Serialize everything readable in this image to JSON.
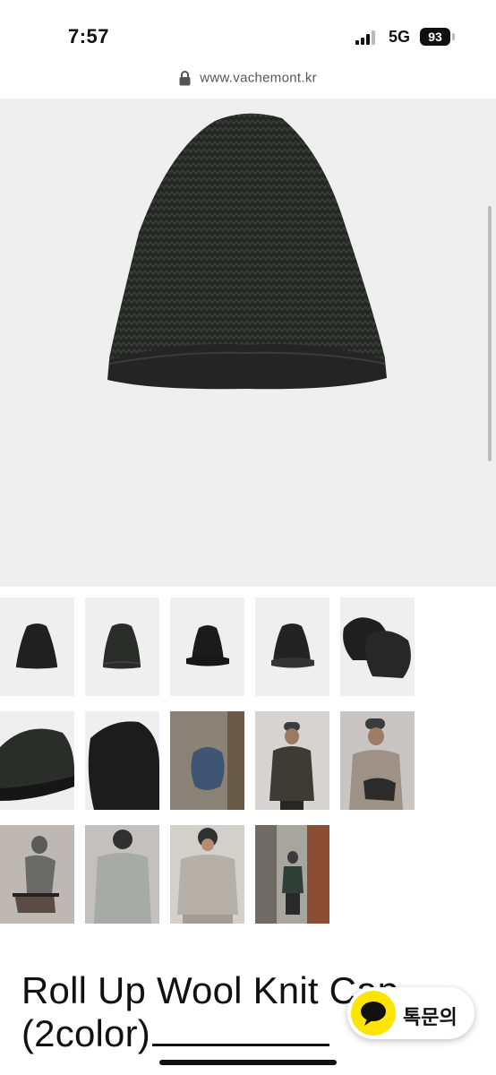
{
  "status_bar": {
    "time": "7:57",
    "network": "5G",
    "battery": "93"
  },
  "browser": {
    "url": "www.vachemont.kr"
  },
  "product": {
    "title_line1": "Roll Up Wool Knit Cap",
    "title_line2": "(2color)"
  },
  "gallery": {
    "thumbnails": [
      "beanie-front",
      "beanie-side",
      "beanie-rolled",
      "beanie-back",
      "beanie-pair",
      "beanie-closeup-left",
      "beanie-closeup-right",
      "beanie-blue-flatlay",
      "model-standing-1",
      "model-seated-holding",
      "model-seated-chair",
      "model-hooded-jacket",
      "model-hood-pose",
      "model-street-alley"
    ]
  },
  "chat_button": {
    "label": "톡문의"
  },
  "colors": {
    "hero_bg": "#efefef",
    "kakao_yellow": "#fde500",
    "beanie": "#2a2c2a"
  }
}
